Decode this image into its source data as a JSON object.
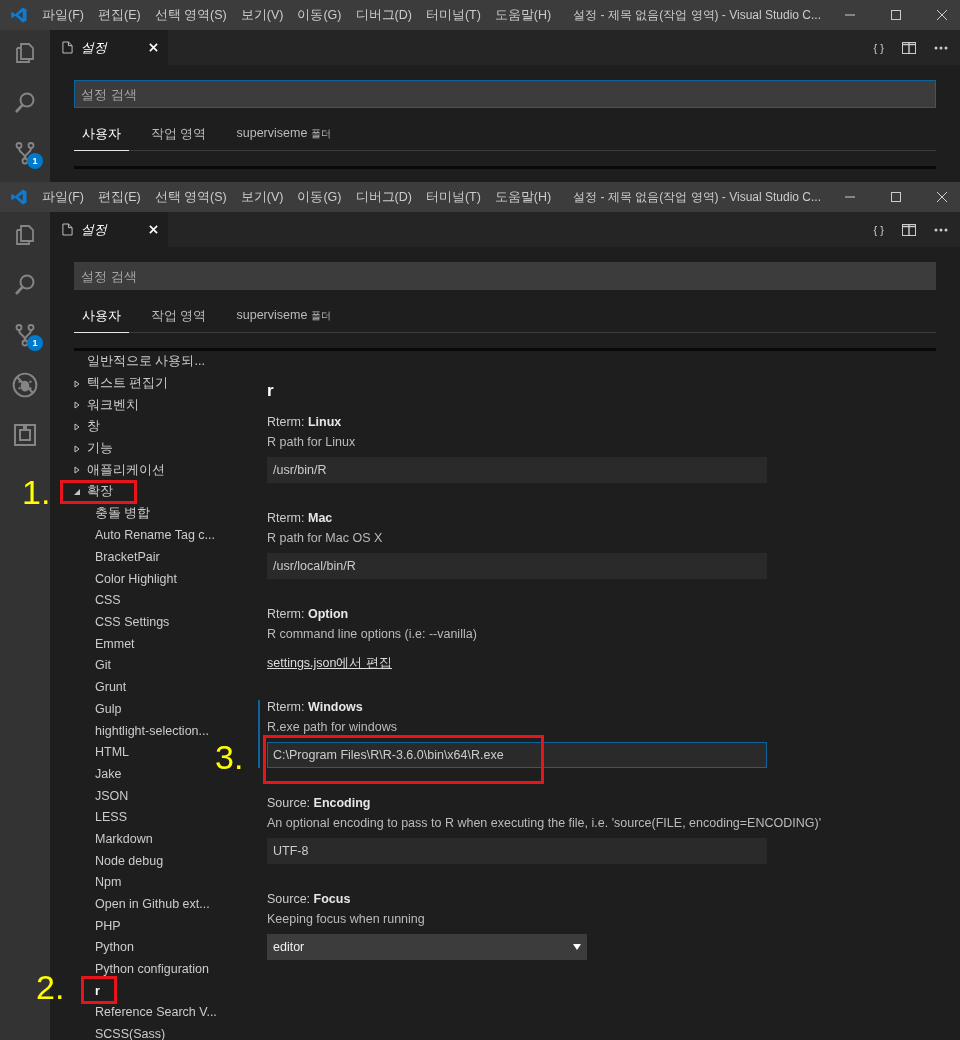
{
  "windows": [
    {
      "menu": [
        "파일(F)",
        "편집(E)",
        "선택 영역(S)",
        "보기(V)",
        "이동(G)",
        "디버그(D)",
        "터미널(T)",
        "도움말(H)"
      ],
      "title": "설정 - 제목 없음(작업 영역) - Visual Studio C...",
      "activity": [
        {
          "kind": "files"
        },
        {
          "kind": "search"
        },
        {
          "kind": "scm",
          "badge": "1"
        }
      ],
      "editor_tab": {
        "label": "설정",
        "json_button": "{ }"
      },
      "search": {
        "placeholder": "설정 검색",
        "focused": true
      },
      "scope_tabs": [
        {
          "label": "사용자",
          "selected": true
        },
        {
          "label": "작업 영역",
          "selected": false
        },
        {
          "label": "superviseme",
          "suffix": "폴더",
          "selected": false
        }
      ]
    },
    {
      "menu": [
        "파일(F)",
        "편집(E)",
        "선택 영역(S)",
        "보기(V)",
        "이동(G)",
        "디버그(D)",
        "터미널(T)",
        "도움말(H)"
      ],
      "title": "설정 - 제목 없음(작업 영역) - Visual Studio C...",
      "activity": [
        {
          "kind": "files"
        },
        {
          "kind": "search"
        },
        {
          "kind": "scm",
          "badge": "1"
        },
        {
          "kind": "debug"
        },
        {
          "kind": "extensions"
        }
      ],
      "editor_tab": {
        "label": "설정",
        "json_button": "{ }"
      },
      "search": {
        "placeholder": "설정 검색",
        "focused": false
      },
      "scope_tabs": [
        {
          "label": "사용자",
          "selected": true
        },
        {
          "label": "작업 영역",
          "selected": false
        },
        {
          "label": "superviseme",
          "suffix": "폴더",
          "selected": false
        }
      ],
      "tree": [
        {
          "label": "일반적으로 사용되...",
          "selected": false
        },
        {
          "label": "텍스트 편집기",
          "expanded": false,
          "selected": false
        },
        {
          "label": "워크벤치",
          "expanded": false,
          "selected": false
        },
        {
          "label": "창",
          "expanded": false,
          "selected": false
        },
        {
          "label": "기능",
          "expanded": false,
          "selected": false
        },
        {
          "label": "애플리케이션",
          "expanded": false,
          "selected": false
        },
        {
          "label": "확장",
          "expanded": true,
          "selected": false,
          "annotation": "1.",
          "children": [
            {
              "label": "충돌 병합",
              "selected": false
            },
            {
              "label": "Auto Rename Tag c...",
              "selected": false
            },
            {
              "label": "BracketPair",
              "selected": false
            },
            {
              "label": "Color Highlight",
              "selected": false
            },
            {
              "label": "CSS",
              "selected": false
            },
            {
              "label": "CSS Settings",
              "selected": false
            },
            {
              "label": "Emmet",
              "selected": false
            },
            {
              "label": "Git",
              "selected": false
            },
            {
              "label": "Grunt",
              "selected": false
            },
            {
              "label": "Gulp",
              "selected": false
            },
            {
              "label": "hightlight-selection...",
              "selected": false
            },
            {
              "label": "HTML",
              "selected": false
            },
            {
              "label": "Jake",
              "selected": false
            },
            {
              "label": "JSON",
              "selected": false
            },
            {
              "label": "LESS",
              "selected": false
            },
            {
              "label": "Markdown",
              "selected": false
            },
            {
              "label": "Node debug",
              "selected": false
            },
            {
              "label": "Npm",
              "selected": false
            },
            {
              "label": "Open in Github ext...",
              "selected": false
            },
            {
              "label": "PHP",
              "selected": false
            },
            {
              "label": "Python",
              "selected": false
            },
            {
              "label": "Python configuration",
              "selected": false
            },
            {
              "label": "r",
              "selected": true,
              "annotation": "2."
            },
            {
              "label": "Reference Search V...",
              "selected": false
            },
            {
              "label": "SCSS(Sass)",
              "selected": false
            }
          ]
        }
      ],
      "section_title": "r",
      "settings": [
        {
          "category": "Rterm:",
          "name": "Linux",
          "description": "R path for Linux",
          "kind": "text",
          "value": "/usr/bin/R",
          "focused": false
        },
        {
          "category": "Rterm:",
          "name": "Mac",
          "description": "R path for Mac OS X",
          "kind": "text",
          "value": "/usr/local/bin/R",
          "focused": false
        },
        {
          "category": "Rterm:",
          "name": "Option",
          "description": "R command line options (i.e: --vanilla)",
          "kind": "link",
          "link": "settings.json에서 편집",
          "focused": false
        },
        {
          "category": "Rterm:",
          "name": "Windows",
          "description": "R.exe path for windows",
          "kind": "text",
          "value": "C:\\Program Files\\R\\R-3.6.0\\bin\\x64\\R.exe",
          "focused": true,
          "annotation": "3."
        },
        {
          "category": "Source:",
          "name": "Encoding",
          "description": "An optional encoding to pass to R when executing the file, i.e. 'source(FILE, encoding=ENCODING)'",
          "kind": "text",
          "value": "UTF-8",
          "focused": false
        },
        {
          "category": "Source:",
          "name": "Focus",
          "description": "Keeping focus when running",
          "kind": "select",
          "value": "editor",
          "focused": false
        }
      ]
    }
  ]
}
